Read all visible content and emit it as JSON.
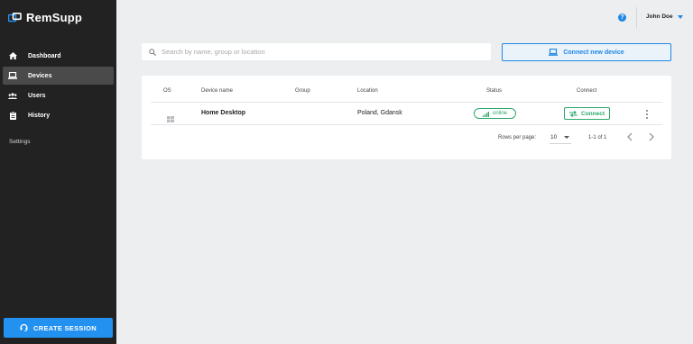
{
  "app": {
    "name": "RemSupp"
  },
  "sidebar": {
    "items": [
      {
        "label": "Dashboard",
        "icon": "home-icon"
      },
      {
        "label": "Devices",
        "icon": "laptop-icon",
        "active": true
      },
      {
        "label": "Users",
        "icon": "users-icon"
      },
      {
        "label": "History",
        "icon": "clipboard-icon"
      }
    ],
    "settings_label": "Settings",
    "create_session_label": "CREATE SESSION"
  },
  "header": {
    "help_icon": "help-icon",
    "user_name": "John Doe"
  },
  "search": {
    "placeholder": "Search by name, group or location",
    "value": ""
  },
  "connect_new_label": "Connect new device",
  "table": {
    "columns": [
      "OS",
      "Device name",
      "Group",
      "Location",
      "Status",
      "Connect"
    ],
    "rows": [
      {
        "os_icon": "windows-icon",
        "device_name": "Home Desktop",
        "group": "",
        "location": "Poland, Gdansk",
        "status": "online",
        "connect_label": "Connect"
      }
    ]
  },
  "pagination": {
    "rows_per_page_label": "Rows per page:",
    "rows_per_page": "10",
    "range": "1-1 of 1"
  },
  "colors": {
    "accent": "#1f87e5",
    "online": "#2aa86a",
    "sidebar_bg": "#222222",
    "create_session_bg": "#2391f0"
  }
}
